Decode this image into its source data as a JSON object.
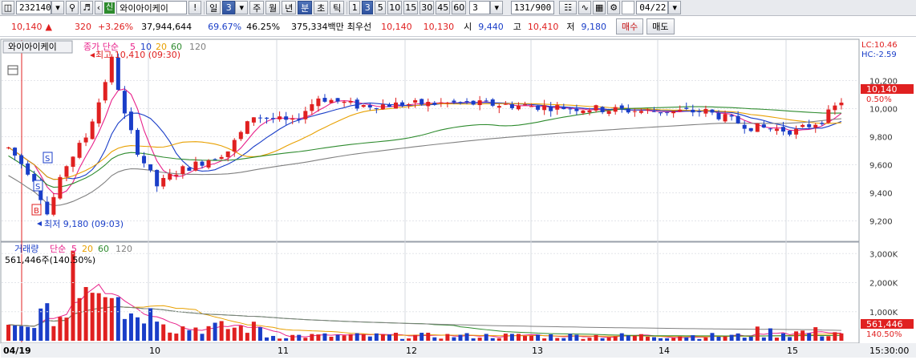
{
  "toolbar": {
    "code": "232140",
    "sin_badge": "신",
    "stock_name": "와이아이케이",
    "period_day": "일",
    "period_day_count": "3",
    "period_week": "주",
    "period_month": "월",
    "period_year": "년",
    "period_minute": "분",
    "period_second": "초",
    "period_tick": "틱",
    "intervals": [
      "1",
      "3",
      "5",
      "10",
      "15",
      "30",
      "45",
      "60"
    ],
    "interval_custom": "3",
    "count": "131/900",
    "date": "04/22"
  },
  "quote": {
    "price": "10,140",
    "change": "320",
    "change_pct": "+3.26%",
    "volume": "37,944,644",
    "ratio1": "69.67%",
    "ratio2": "46.25%",
    "amount": "375,334백만",
    "priority_label": "최우선",
    "ask": "10,140",
    "bid": "10,130",
    "open_label": "시",
    "open": "9,440",
    "high_label": "고",
    "high": "10,410",
    "low_label": "저",
    "low": "9,180",
    "buy_button": "매수",
    "sell_button": "매도"
  },
  "price_panel": {
    "tab_label": "와이아이케이",
    "legend_title": "종가 단순",
    "ma_periods": [
      "5",
      "10",
      "20",
      "60",
      "120"
    ],
    "ma_colors": [
      "#e8208a",
      "#1a3ec8",
      "#e8a000",
      "#2e8b2e",
      "#808080"
    ],
    "high_annotation": "최고 10,410 (09:30)",
    "low_annotation": "최저 9,180 (09:03)",
    "lc_label": "LC:10.46",
    "hc_label": "HC:-2.59",
    "y_ticks": [
      "10,200",
      "10,000",
      "9,800",
      "9,600",
      "9,400",
      "9,200"
    ],
    "current_price_tag": "10,140",
    "current_pct_tag": "0.50%",
    "signal_s": "S",
    "signal_b": "B"
  },
  "volume_panel": {
    "legend_title": "거래량",
    "legend_ma": "단순",
    "ma_periods": [
      "5",
      "20",
      "60",
      "120"
    ],
    "ma_colors": [
      "#e8208a",
      "#e8a000",
      "#2e8b2e",
      "#808080"
    ],
    "volume_readout": "561,446주(140.50%)",
    "y_ticks": [
      "3,000K",
      "2,000K",
      "1,000K"
    ],
    "current_volume_tag": "561,446",
    "current_pct_tag": "140.50%"
  },
  "x_axis": {
    "labels": [
      "04/19",
      "10",
      "11",
      "12",
      "13",
      "14",
      "15"
    ],
    "time_readout": "15:30:00"
  },
  "colors": {
    "up": "#e02020",
    "down": "#1a3ec8",
    "accent": "#2f53a0"
  }
}
